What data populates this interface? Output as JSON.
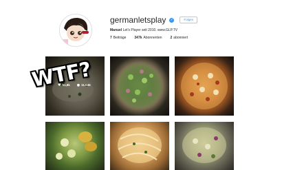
{
  "profile": {
    "username": "germanletsplay",
    "verified_icon": "verified-badge-icon",
    "follow_label": "Folgen",
    "bio_name": "Manuel",
    "bio_text": "Let's Player seit 2010. www.GLP.TV",
    "stats": [
      {
        "value": "7",
        "label": "Beiträge"
      },
      {
        "value": "347k",
        "label": "Abonnenten"
      },
      {
        "value": "2",
        "label": "abonniert"
      }
    ]
  },
  "posts": [
    {
      "likes": "51,8k",
      "comments": "11.045",
      "hover": true
    },
    {
      "hover": false
    },
    {
      "hover": false
    },
    {
      "hover": false
    },
    {
      "hover": false
    },
    {
      "hover": false
    }
  ],
  "sticker": {
    "text": "WTF?"
  },
  "colors": {
    "accent": "#3897f0",
    "text": "#262626",
    "background": "#ffffff"
  }
}
